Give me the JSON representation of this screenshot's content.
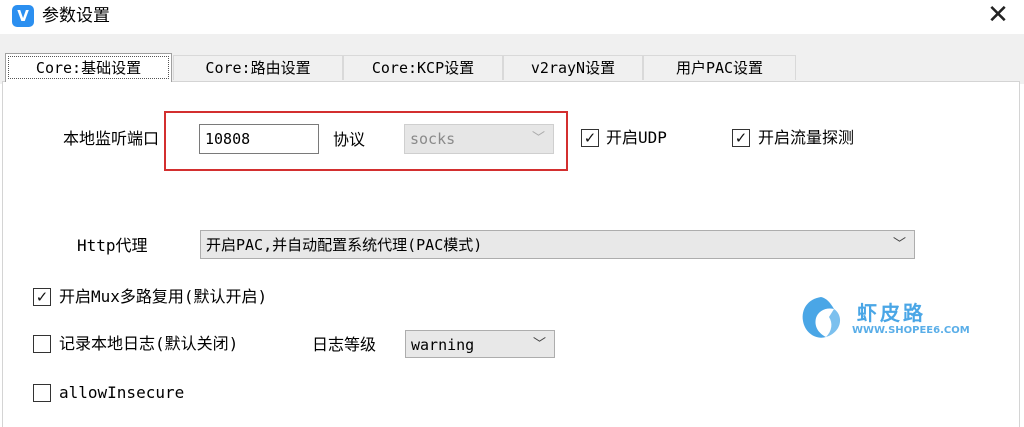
{
  "window": {
    "title": "参数设置",
    "app_icon": "V"
  },
  "tabs": [
    {
      "label": "Core:基础设置",
      "active": true
    },
    {
      "label": "Core:路由设置",
      "active": false
    },
    {
      "label": "Core:KCP设置",
      "active": false
    },
    {
      "label": "v2rayN设置",
      "active": false
    },
    {
      "label": "用户PAC设置",
      "active": false
    }
  ],
  "form": {
    "local_port_label": "本地监听端口",
    "local_port_value": "10808",
    "protocol_label": "协议",
    "protocol_value": "socks",
    "udp_label": "开启UDP",
    "udp_checked": true,
    "sniffing_label": "开启流量探测",
    "sniffing_checked": true,
    "http_proxy_label": "Http代理",
    "http_proxy_value": "开启PAC,并自动配置系统代理(PAC模式)",
    "mux_label": "开启Mux多路复用(默认开启)",
    "mux_checked": true,
    "log_label": "记录本地日志(默认关闭)",
    "log_checked": false,
    "log_level_label": "日志等级",
    "log_level_value": "warning",
    "allow_insecure_label": "allowInsecure",
    "allow_insecure_checked": false
  },
  "watermark": {
    "title": "虾皮路",
    "url": "WWW.SHOPEE6.COM"
  },
  "colors": {
    "highlight_box": "#d32f2f",
    "watermark": "#4aa6e6"
  }
}
